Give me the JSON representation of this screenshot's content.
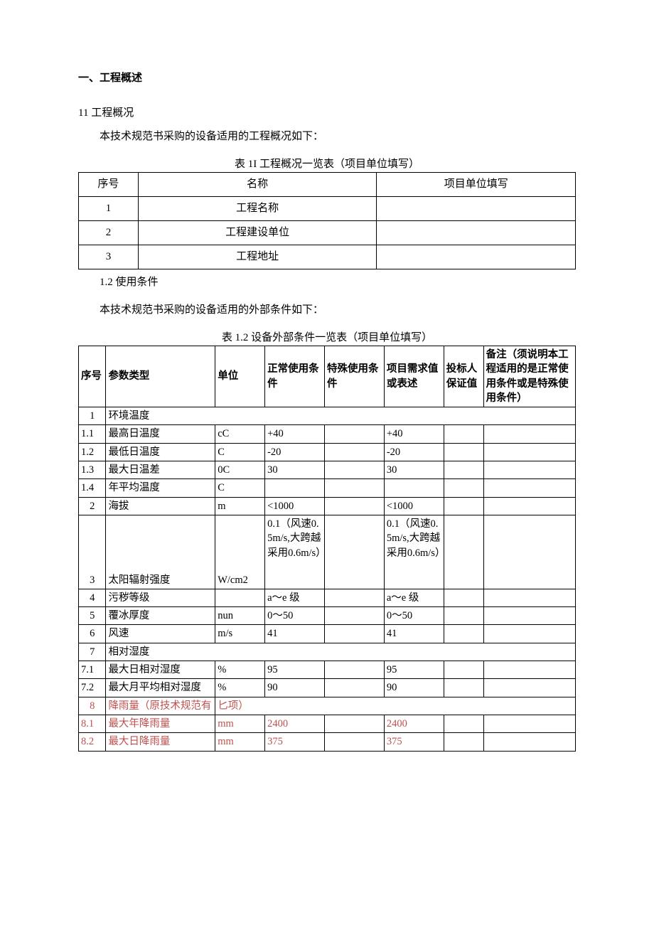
{
  "section_title": "一、工程概述",
  "sub1": "11 工程概况",
  "para1": "本技术规范书采购的设备适用的工程概况如下：",
  "caption1": "表 1I 工程概况一览表（项目单位填写）",
  "tbl1": {
    "headers": [
      "序号",
      "名称",
      "项目单位填写"
    ],
    "rows": [
      {
        "no": "1",
        "name": "工程名称",
        "fill": ""
      },
      {
        "no": "2",
        "name": "工程建设单位",
        "fill": ""
      },
      {
        "no": "3",
        "name": "工程地址",
        "fill": ""
      }
    ]
  },
  "sub2": "1.2 使用条件",
  "para2": "本技术规范书采购的设备适用的外部条件如下：",
  "caption2": "表 1.2 设备外部条件一览表（项目单位填写）",
  "tbl2": {
    "headers": {
      "no": "序号",
      "ptype": "参数类型",
      "unit": "单位",
      "normal": "正常使用条件",
      "special": "特殊使用条件",
      "req": "项目需求值或表述",
      "bid": "投标人保证值",
      "remark": "备注（须说明本工程适用的是正常使用条件或是特殊使用条件）"
    },
    "rows": [
      {
        "no": "1",
        "center": true,
        "ptype": "环境温度",
        "span": true
      },
      {
        "no": "1.1",
        "ptype": "最高日温度",
        "unit": "cC",
        "normal": "+40",
        "special": "",
        "req": "+40",
        "bid": "",
        "remark": ""
      },
      {
        "no": "1.2",
        "ptype": "最低日温度",
        "unit": "C",
        "normal": "-20",
        "special": "",
        "req": "-20",
        "bid": "",
        "remark": ""
      },
      {
        "no": "1.3",
        "ptype": "最大日温差",
        "unit": "0C",
        "normal": "30",
        "special": "",
        "req": "30",
        "bid": "",
        "remark": ""
      },
      {
        "no": "1.4",
        "ptype": "年平均温度",
        "unit": "C",
        "normal": "",
        "special": "",
        "req": "",
        "bid": "",
        "remark": ""
      },
      {
        "no": "2",
        "center": true,
        "ptype": "海拔",
        "unit": "m",
        "normal": "<1000",
        "special": "",
        "req": "<1000",
        "bid": "",
        "remark": ""
      },
      {
        "no": "3",
        "center": true,
        "botalign": true,
        "ptype": "太阳辐射强度",
        "unit": "W/cm2",
        "normal": "0.1（风速0.5m/s,大跨越采用0.6m/s）",
        "special": "",
        "req": "0.1（风速0.5m/s,大跨越采用0.6m/s）",
        "bid": "",
        "remark": ""
      },
      {
        "no": "4",
        "center": true,
        "ptype": "污秽等级",
        "unit": "",
        "normal": "a～e 级",
        "special": "",
        "req": "a～e 级",
        "bid": "",
        "remark": ""
      },
      {
        "no": "5",
        "center": true,
        "ptype": "覆冰厚度",
        "unit": "nun",
        "normal": "0～50",
        "special": "",
        "req": "0～50",
        "bid": "",
        "remark": ""
      },
      {
        "no": "6",
        "center": true,
        "ptype": "风速",
        "unit": "m/s",
        "normal": "41",
        "special": "",
        "req": "41",
        "bid": "",
        "remark": ""
      },
      {
        "no": "7",
        "center": true,
        "ptype": "相对湿度",
        "span": true
      },
      {
        "no": "7.1",
        "ptype": "最大日相对湿度",
        "unit": "%",
        "normal": "95",
        "special": "",
        "req": "95",
        "bid": "",
        "remark": ""
      },
      {
        "no": "7.2",
        "ptype": "最大月平均相对湿度",
        "unit": "%",
        "normal": "90",
        "special": "",
        "req": "90",
        "bid": "",
        "remark": ""
      },
      {
        "no": "8",
        "center": true,
        "red": true,
        "ptype": "降雨量（原技术规范有",
        "unit": "匕项）",
        "span2": true
      },
      {
        "no": "8.1",
        "red": true,
        "ptype": "最大年降雨量",
        "unit": "mm",
        "normal": "2400",
        "special": "",
        "req": "2400",
        "bid": "",
        "remark": ""
      },
      {
        "no": "8.2",
        "red": true,
        "ptype": "最大日降雨量",
        "unit": "mm",
        "normal": "375",
        "special": "",
        "req": "375",
        "bid": "",
        "remark": ""
      }
    ]
  }
}
